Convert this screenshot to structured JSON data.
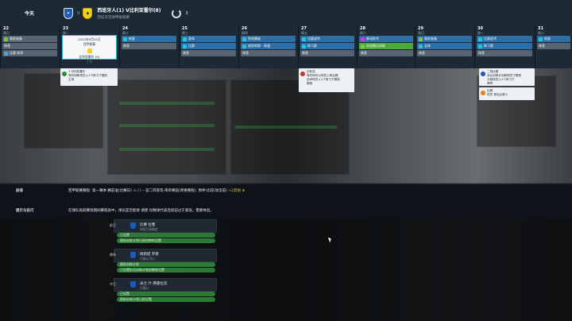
{
  "header": {
    "today_label": "今天",
    "vs_label": "V",
    "match_title": "西班牙人(1) V比利亚雷尔(8)",
    "match_subtitle": "西班牙足球甲级联赛",
    "days_count": "3"
  },
  "calendar": {
    "days": [
      {
        "num": "22",
        "wk": "周日",
        "rows": [
          {
            "label": "赛前准备",
            "style": "grey",
            "icon": "#7ac943"
          },
          {
            "label": "休息",
            "style": "grey",
            "icon": ""
          },
          {
            "label": "比赛 前季",
            "style": "grey",
            "icon": "#4aa3df"
          }
        ]
      },
      {
        "num": "23",
        "wk": "周一",
        "match": {
          "time": "2022年9月12日",
          "league": "西甲联赛",
          "opponent": "比利亚雷尔 (H)",
          "status": "主场"
        }
      },
      {
        "num": "24",
        "wk": "周二",
        "rows": [
          {
            "label": "恢复",
            "style": "blue",
            "icon": "#29c2d6"
          },
          {
            "label": "休息",
            "style": "grey",
            "icon": ""
          }
        ]
      },
      {
        "num": "25",
        "wk": "周三",
        "rows": [
          {
            "label": "身体",
            "style": "blue",
            "icon": "#29c2d6"
          },
          {
            "label": "比赛",
            "style": "blue",
            "icon": "#29c2d6"
          },
          {
            "label": "休息",
            "style": "grey",
            "icon": ""
          }
        ]
      },
      {
        "num": "26",
        "wk": "周四",
        "rows": [
          {
            "label": "防线基础",
            "style": "blue",
            "icon": "#29c2d6"
          },
          {
            "label": "攻防转换 - 高速",
            "style": "blue",
            "icon": "#29c2d6"
          },
          {
            "label": "休息",
            "style": "grey",
            "icon": ""
          }
        ]
      },
      {
        "num": "27",
        "wk": "周五",
        "rows": [
          {
            "label": "比赛战术",
            "style": "blue",
            "icon": "#29c2d6"
          },
          {
            "label": "练习赛",
            "style": "blue",
            "icon": "#29c2d6"
          },
          {
            "label": "休息",
            "style": "grey",
            "icon": ""
          }
        ]
      },
      {
        "num": "28",
        "wk": "周六",
        "rows": [
          {
            "label": "移动防守",
            "style": "blue",
            "icon": "#c23dd6"
          },
          {
            "label": "进攻跑位训练",
            "style": "green",
            "icon": "#7ac943"
          },
          {
            "label": "休息",
            "style": "grey",
            "icon": ""
          }
        ]
      },
      {
        "num": "29",
        "wk": "周日",
        "rows": [
          {
            "label": "赛前准备",
            "style": "blue",
            "icon": "#7ac943"
          },
          {
            "label": "全体",
            "style": "blue",
            "icon": "#29c2d6"
          },
          {
            "label": "休息",
            "style": "grey",
            "icon": ""
          }
        ]
      },
      {
        "num": "30",
        "wk": "周一",
        "rows": [
          {
            "label": "比赛战术",
            "style": "blue",
            "icon": "#29c2d6"
          },
          {
            "label": "练习赛",
            "style": "blue",
            "icon": "#29c2d6"
          },
          {
            "label": "休息",
            "style": "grey",
            "icon": ""
          }
        ]
      },
      {
        "num": "31",
        "wk": "周二",
        "rows": [
          {
            "label": "恢复",
            "style": "blue",
            "icon": "#29c2d6"
          },
          {
            "label": "休息",
            "style": "grey",
            "icon": ""
          }
        ]
      }
    ]
  },
  "notes": [
    {
      "text": "1 可利亚雷尔\n有时间和球员入1个练习下赛前\n主场",
      "color": "#2c8a3a"
    },
    {
      "text": "比利亚\n有时间可以球员入练比赛\n战术球员入1个练习下赛前\n赛程",
      "color": "#c0392b"
    },
    {
      "text": "二场比赛\n对比训练计划和球员下赛前\n分组球员入1个练习下\n赛程",
      "color": "#1f5bb5"
    },
    {
      "text": "比赛\n球员 参加比赛人",
      "color": "#e67e22"
    }
  ],
  "details": {
    "row1_label": "前排",
    "row1_text": "西甲联赛赛程: 第一赛季·赛前准(比赛日) ⚠ / / ⋯首二阵容等·简单赛前(简要赛程), 预神·比较(攻坚前)",
    "row1_hl": "+2其他 ⊕",
    "row2_label": "提示与技巧",
    "row2_text": "在球队再就赛场期间赛程表中，球员是否能够 请使 份数球代表连续前过于紧张，需要休息。"
  },
  "lower": {
    "items": [
      {
        "tag": "前卫",
        "title": "比赛 拉塞",
        "sub": "阵容已经确定"
      },
      {
        "tag": "替补",
        "title": "梅斯提 罗斯",
        "sub": "已确认可以"
      },
      {
        "tag": "中卫",
        "title": "米兰 什·弗雷拉克",
        "sub": "已确认"
      }
    ],
    "bars": [
      "已设置",
      "赛前训练计划已经由教练设置",
      "赛前训练计划",
      "已设置队伍训练计划由教练设置",
      "已设置",
      "赛前训练计划已经设置"
    ]
  }
}
